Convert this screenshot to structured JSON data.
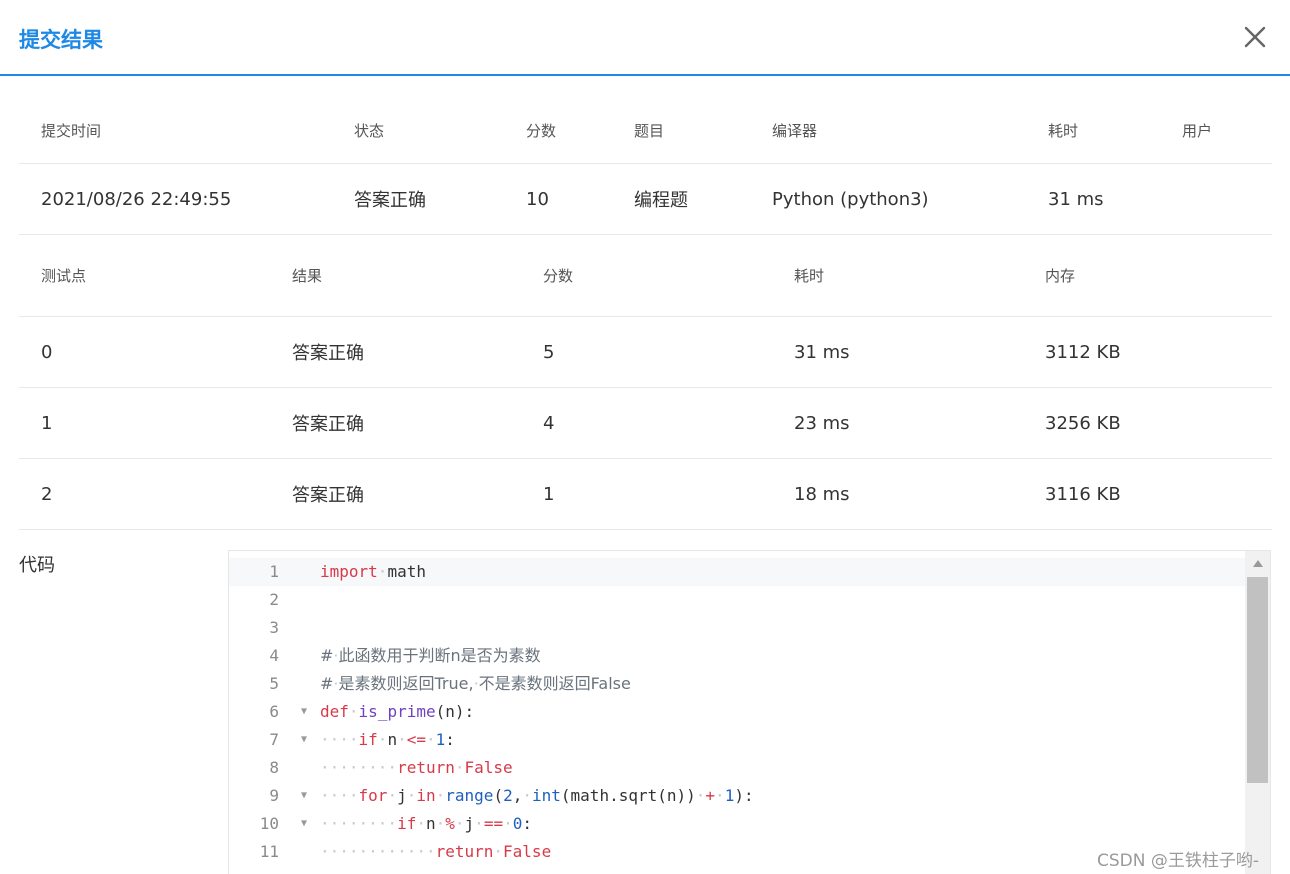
{
  "dialog": {
    "title": "提交结果",
    "close_icon": "close-icon"
  },
  "summary": {
    "headers": [
      "提交时间",
      "状态",
      "分数",
      "题目",
      "编译器",
      "耗时",
      "用户"
    ],
    "row": {
      "time": "2021/08/26 22:49:55",
      "status": "答案正确",
      "score": "10",
      "problem": "编程题",
      "compiler": "Python (python3)",
      "duration": "31 ms",
      "user": ""
    }
  },
  "cases": {
    "headers": [
      "测试点",
      "结果",
      "分数",
      "耗时",
      "内存"
    ],
    "rows": [
      {
        "id": "0",
        "result": "答案正确",
        "score": "5",
        "time": "31 ms",
        "memory": "3112 KB"
      },
      {
        "id": "1",
        "result": "答案正确",
        "score": "4",
        "time": "23 ms",
        "memory": "3256 KB"
      },
      {
        "id": "2",
        "result": "答案正确",
        "score": "1",
        "time": "18 ms",
        "memory": "3116 KB"
      }
    ]
  },
  "code": {
    "label": "代码",
    "line_numbers": [
      "1",
      "2",
      "3",
      "4",
      "5",
      "6",
      "7",
      "8",
      "9",
      "10",
      "11"
    ],
    "lines": [
      "import math",
      "",
      "",
      "# 此函数用于判断n是否为素数",
      "# 是素数则返回True, 不是素数则返回False",
      "def is_prime(n):",
      "    if n <= 1:",
      "        return False",
      "    for j in range(2, int(math.sqrt(n)) + 1):",
      "        if n % j == 0:",
      "            return False"
    ]
  },
  "colors": {
    "accent": "#1e88e5",
    "success": "#e53935"
  },
  "watermark": "CSDN @王铁柱子哟-"
}
